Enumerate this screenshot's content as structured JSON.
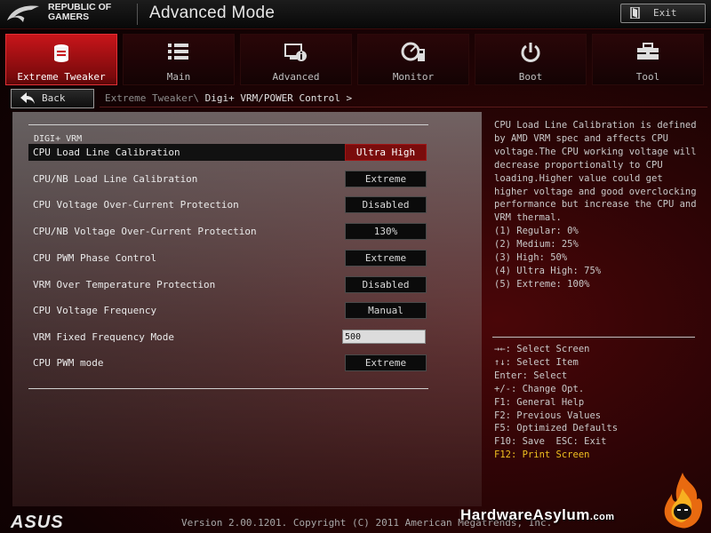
{
  "header": {
    "brand_line1": "REPUBLIC OF",
    "brand_line2": "GAMERS",
    "mode_title": "Advanced Mode",
    "exit_label": "Exit"
  },
  "tabs": [
    {
      "label": "Extreme Tweaker",
      "icon": "tweaker-icon",
      "active": true
    },
    {
      "label": "Main",
      "icon": "list-icon",
      "active": false
    },
    {
      "label": "Advanced",
      "icon": "advanced-info-icon",
      "active": false
    },
    {
      "label": "Monitor",
      "icon": "monitor-gauge-icon",
      "active": false
    },
    {
      "label": "Boot",
      "icon": "power-icon",
      "active": false
    },
    {
      "label": "Tool",
      "icon": "toolbox-icon",
      "active": false
    }
  ],
  "nav": {
    "back_label": "Back",
    "breadcrumb_parent": "Extreme Tweaker\\",
    "breadcrumb_current": "Digi+ VRM/POWER Control",
    "breadcrumb_arrow": ">"
  },
  "main": {
    "section_title": "DIGI+ VRM",
    "settings": [
      {
        "label": "CPU Load Line Calibration",
        "value": "Ultra High",
        "selected": true
      },
      {
        "label": "CPU/NB Load Line Calibration",
        "value": "Extreme"
      },
      {
        "label": "CPU Voltage Over-Current Protection",
        "value": "Disabled"
      },
      {
        "label": "CPU/NB Voltage Over-Current Protection",
        "value": "130%"
      },
      {
        "label": "CPU PWM Phase Control",
        "value": "Extreme"
      },
      {
        "label": "VRM Over Temperature Protection",
        "value": "Disabled"
      },
      {
        "label": "CPU Voltage Frequency",
        "value": "Manual"
      },
      {
        "label": "VRM Fixed Frequency Mode",
        "value": "500"
      },
      {
        "label": "CPU PWM mode",
        "value": "Extreme"
      }
    ]
  },
  "help": {
    "description": "CPU Load Line Calibration is defined\nby AMD VRM spec and affects CPU\nvoltage.The CPU working voltage will\ndecrease proportionally to CPU\nloading.Higher value could get\nhigher voltage and good overclocking\nperformance but increase the CPU and\nVRM thermal.\n(1) Regular: 0%\n(2) Medium: 25%\n(3) High: 50%\n(4) Ultra High: 75%\n(5) Extreme: 100%",
    "keys": [
      "→←: Select Screen",
      "↑↓: Select Item",
      "Enter: Select",
      "+/-: Change Opt.",
      "F1: General Help",
      "F2: Previous Values",
      "F5: Optimized Defaults",
      "F10: Save  ESC: Exit",
      "F12: Print Screen"
    ]
  },
  "footer": {
    "asus_logo": "ASUS",
    "version": "Version 2.00.1201. Copyright (C) 2011 American Megatrends, Inc.",
    "watermark": "HardwareAsylum",
    "watermark_suffix": ".com"
  },
  "colors": {
    "accent_red": "#c8151a",
    "selected_value_bg": "#7a0c0c",
    "highlight_key": "#f0c020"
  }
}
